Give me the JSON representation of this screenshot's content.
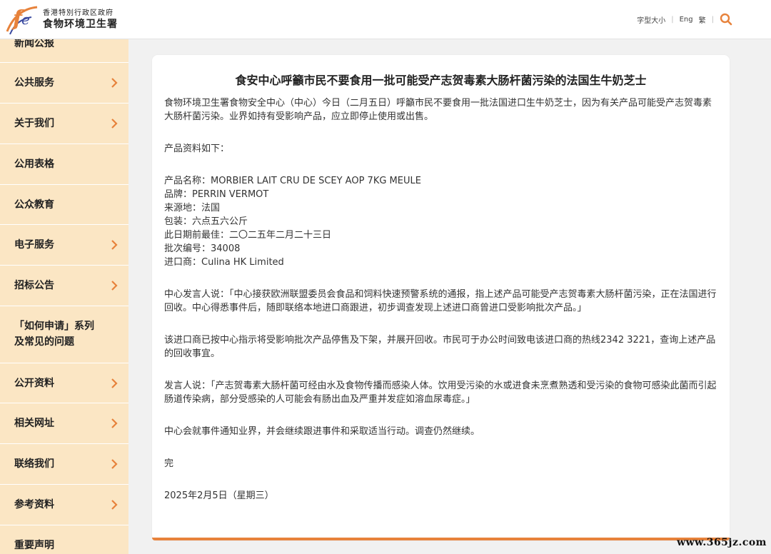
{
  "header": {
    "org_sub": "香港特別行政区政府",
    "org_name": "食物环境卫生署",
    "font_size_label": "字型大小",
    "lang_en": "Eng",
    "lang_trad": "繁",
    "brand_color": "#e7823b"
  },
  "sidebar": {
    "items": [
      {
        "label": "新闻公报",
        "has_arrow": false
      },
      {
        "label": "公共服务",
        "has_arrow": true
      },
      {
        "label": "关于我们",
        "has_arrow": true
      },
      {
        "label": "公用表格",
        "has_arrow": false
      },
      {
        "label": "公众教育",
        "has_arrow": false
      },
      {
        "label": "电子服务",
        "has_arrow": true
      },
      {
        "label": "招标公告",
        "has_arrow": true
      },
      {
        "label": "「如何申请」系列及常见的问题",
        "has_arrow": false
      },
      {
        "label": "公开资料",
        "has_arrow": true
      },
      {
        "label": "相关网址",
        "has_arrow": true
      },
      {
        "label": "联络我们",
        "has_arrow": true
      },
      {
        "label": "参考资料",
        "has_arrow": true
      },
      {
        "label": "重要声明",
        "has_arrow": false
      }
    ]
  },
  "article": {
    "title": "食安中心呼籲市民不要食用一批可能受产志贺毒素大肠杆菌污染的法国生牛奶芝士",
    "intro": "食物环境卫生署食物安全中心（中心）今日（二月五日）呼籲市民不要食用一批法国进口生牛奶芝士，因为有关产品可能受产志贺毒素大肠杆菌污染。业界如持有受影响产品，应立即停止使用或出售。",
    "details_heading": "产品资料如下：",
    "details": [
      "产品名称：MORBIER LAIT CRU DE SCEY AOP 7KG MEULE",
      "品牌：PERRIN VERMOT",
      "来源地：法国",
      "包装：六点五六公斤",
      "此日期前最佳：二〇二五年二月二十三日",
      "批次编号：34008",
      "进口商：Culina HK Limited"
    ],
    "para2": "中心发言人说：「中心接获欧洲联盟委员会食品和饲料快速预警系统的通报，指上述产品可能受产志贺毒素大肠杆菌污染，正在法国进行回收。中心得悉事件后，随即联络本地进口商跟进，初步调查发现上述进口商曾进口受影响批次产品。」",
    "para3": "该进口商已按中心指示将受影响批次产品停售及下架，并展开回收。市民可于办公时间致电该进口商的热线2342 3221，查询上述产品的回收事宜。",
    "para4": "发言人说：「产志贺毒素大肠杆菌可经由水及食物传播而感染人体。饮用受污染的水或进食未烹煮熟透和受污染的食物可感染此菌而引起肠道传染病，部分受感染的人可能会有肠出血及严重并发症如溶血尿毒症。」",
    "para5": "中心会就事件通知业界，并会继续跟进事件和采取适当行动。调查仍然继续。",
    "end": "完",
    "date": "2025年2月5日（星期三）"
  },
  "watermark": "www.365jz.com"
}
